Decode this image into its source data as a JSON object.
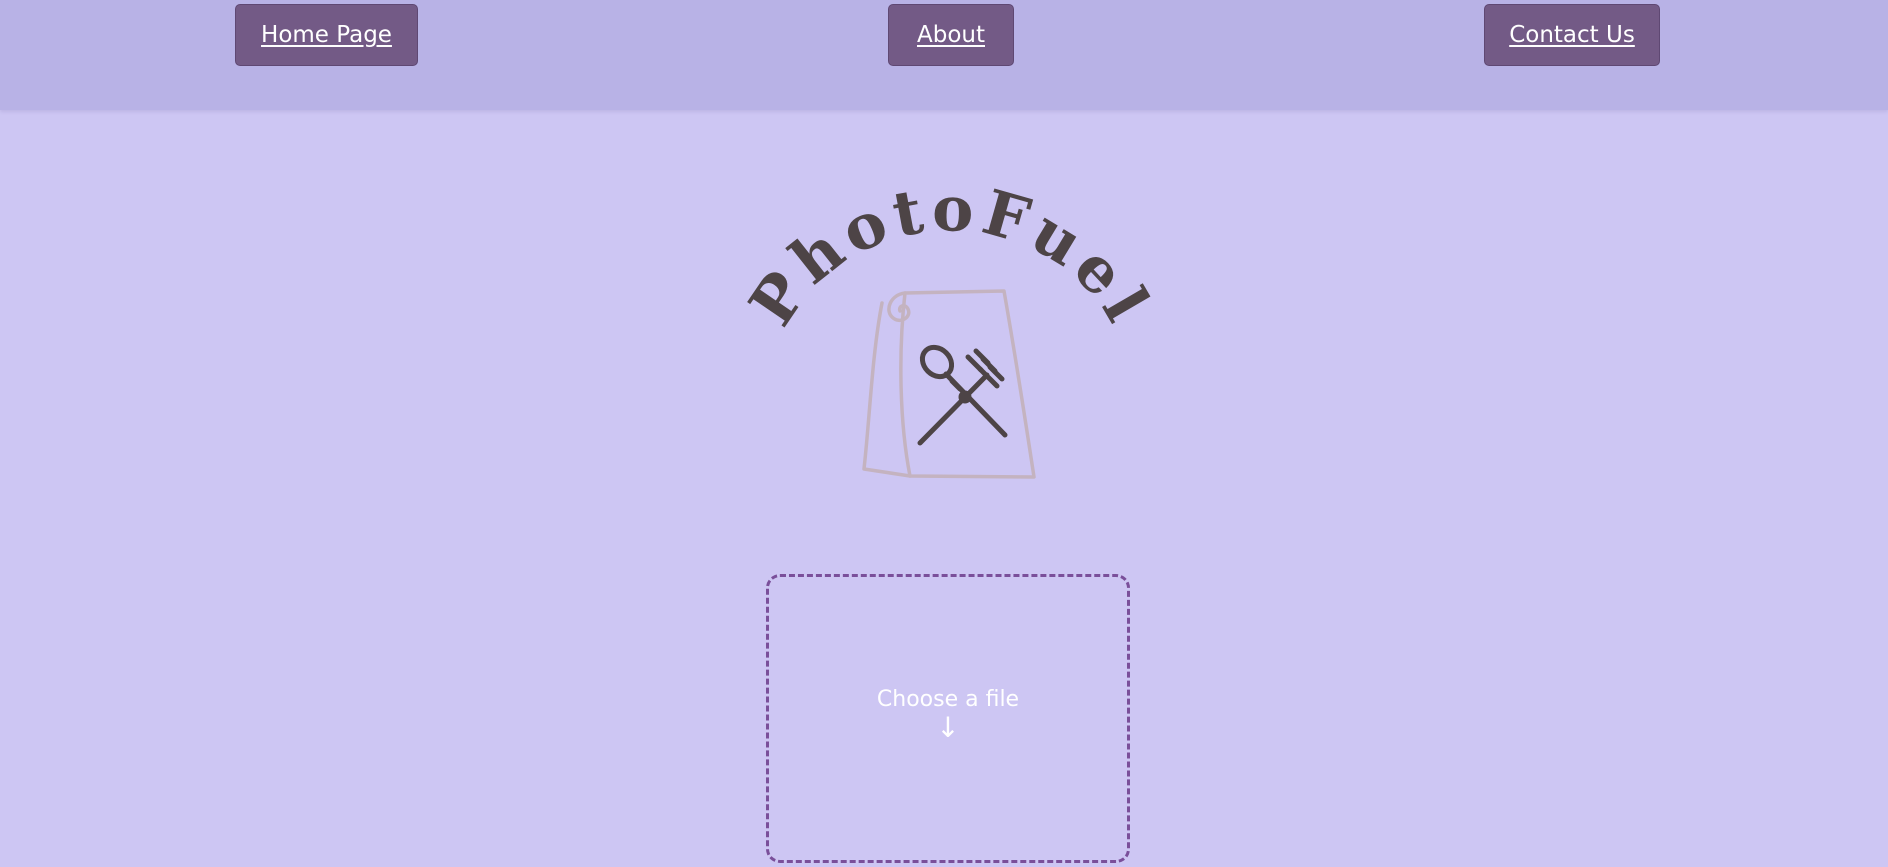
{
  "nav": {
    "home_label": "Home Page",
    "about_label": "About",
    "contact_label": "Contact Us"
  },
  "logo": {
    "text": "PhotoFuel",
    "icon": "menu-scroll-with-spoon-and-fork-icon"
  },
  "upload": {
    "label": "Choose a file",
    "arrow": "↓",
    "icon": "down-arrow-icon"
  },
  "colors": {
    "page_background": "#cdc6f3",
    "navbar_background": "#b8b2e6",
    "button_background": "#735a86",
    "button_text": "#ffffff",
    "logo_text": "#4d4446",
    "logo_scroll": "#c4b3c0",
    "dropzone_border": "#7a4f9a"
  }
}
